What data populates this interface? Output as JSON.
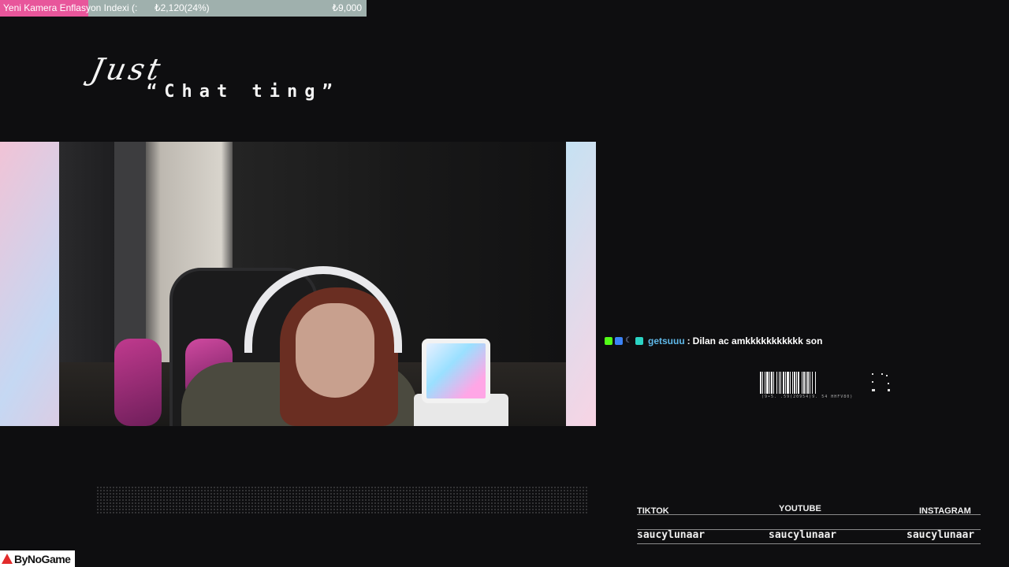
{
  "goal": {
    "label": "Yeni Kamera Enflasyon Indexi (:",
    "current": "₺2,120(24%)",
    "target": "₺9,000",
    "progress_fraction": 0.24,
    "fill_color": "#e8569b",
    "track_color": "#9fb0ad"
  },
  "title": {
    "line1": "Just",
    "line2": "“Chat ting”"
  },
  "chat": {
    "username": "getsuuu",
    "separator": ":",
    "message": "Dilan ac amkkkkkkkkkkk son",
    "badges": [
      "kick-badge",
      "verified-badge",
      "moon-badge",
      "gift-badge"
    ],
    "username_color": "#5fb8e8"
  },
  "barcode": {
    "caption": "(9•5. .59(20954)9. 54 HHFV80)"
  },
  "socials": [
    {
      "platform": "TIKTOK",
      "handle": "saucylunaar"
    },
    {
      "platform": "YOUTUBE",
      "handle": "saucylunaar"
    },
    {
      "platform": "INSTAGRAM",
      "handle": "saucylunaar"
    }
  ],
  "logo": {
    "text": "ByNoGame"
  }
}
